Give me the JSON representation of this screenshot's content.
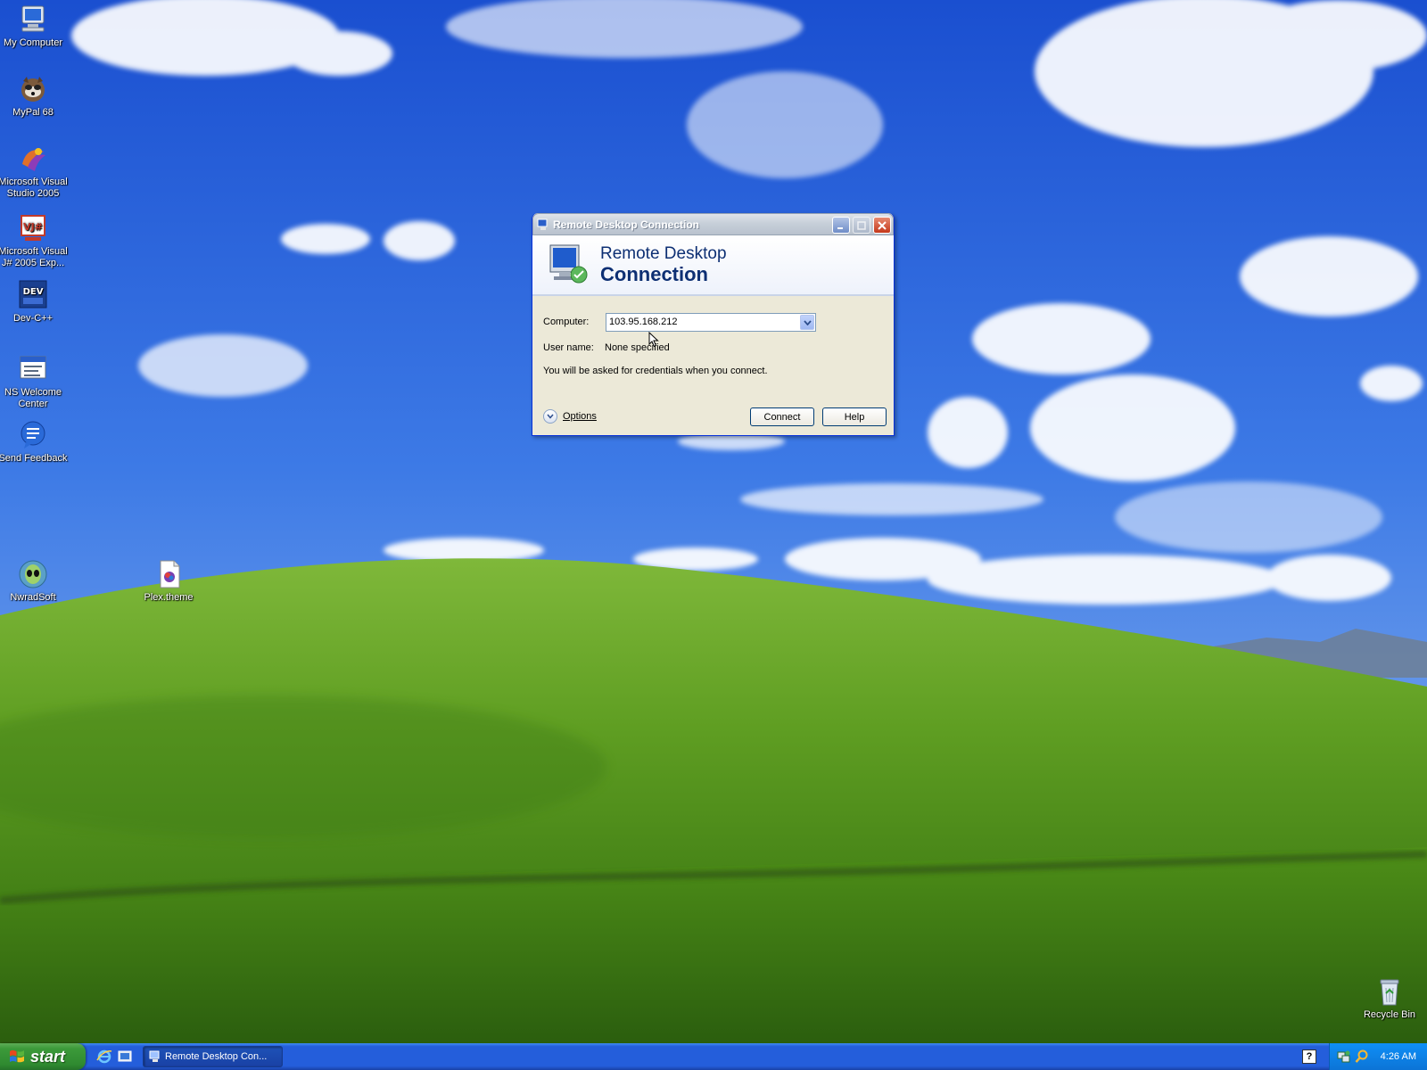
{
  "desktop": {
    "icons": [
      {
        "label": "My Computer"
      },
      {
        "label": "MyPal 68"
      },
      {
        "label": "Microsoft Visual Studio 2005"
      },
      {
        "label": "Microsoft Visual J# 2005 Exp..."
      },
      {
        "label": "Dev-C++"
      },
      {
        "label": "NS Welcome Center"
      },
      {
        "label": "Send Feedback"
      },
      {
        "label": "NwradSoft"
      },
      {
        "label": "Plex.theme"
      },
      {
        "label": "Recycle Bin"
      }
    ]
  },
  "dialog": {
    "title": "Remote Desktop Connection",
    "banner_line1": "Remote Desktop",
    "banner_line2": "Connection",
    "computer_label": "Computer:",
    "computer_value": "103.95.168.212",
    "username_label": "User name:",
    "username_value": "None specified",
    "info_text": "You will be asked for credentials when you connect.",
    "options_label": "Options",
    "connect_label": "Connect",
    "help_label": "Help"
  },
  "taskbar": {
    "start_label": "start",
    "task_label": "Remote Desktop Con...",
    "help_tray": "?",
    "clock": "4:26 AM"
  },
  "colors": {
    "titlebar_inactive": "#c7cfd9",
    "taskbar_blue": "#245edb",
    "start_green": "#3c9a3a",
    "tray_blue": "#0c74d6"
  }
}
